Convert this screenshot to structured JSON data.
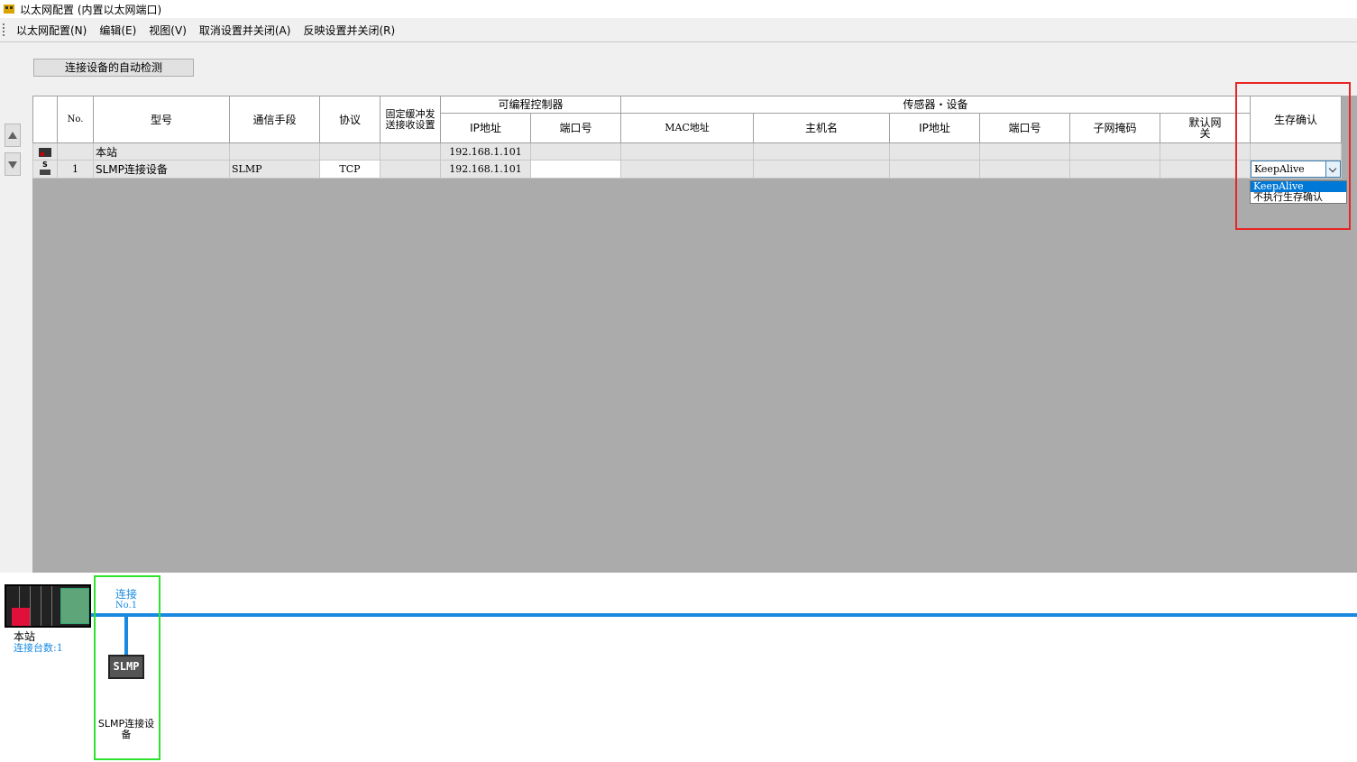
{
  "window": {
    "title": "以太网配置 (内置以太网端口)"
  },
  "menu": [
    {
      "label": "以太网配置(N)"
    },
    {
      "label": "编辑(E)"
    },
    {
      "label": "视图(V)"
    },
    {
      "label": "取消设置并关闭(A)"
    },
    {
      "label": "反映设置并关闭(R)"
    }
  ],
  "toolbar": {
    "auto_detect_label": "连接设备的自动检测"
  },
  "grid": {
    "headers": {
      "no": "No.",
      "model": "型号",
      "comm_means": "通信手段",
      "protocol": "协议",
      "fixed_buffer": "固定缓冲发送接收设置",
      "plc_group": "可编程控制器",
      "plc_ip": "IP地址",
      "plc_port": "端口号",
      "sensor_group": "传感器・设备",
      "mac": "MAC地址",
      "hostname": "主机名",
      "dev_ip": "IP地址",
      "dev_port": "端口号",
      "subnet": "子网掩码",
      "gateway": "默认网关",
      "alive_check": "生存确认"
    },
    "rows": [
      {
        "no": "",
        "model": "本站",
        "comm": "",
        "protocol": "",
        "fixed": "",
        "plc_ip": "192.168.1.101",
        "plc_port": "",
        "alive": ""
      },
      {
        "no": "1",
        "model": "SLMP连接设备",
        "comm": "SLMP",
        "protocol": "TCP",
        "fixed": "",
        "plc_ip": "192.168.1.101",
        "plc_port": "",
        "alive": "KeepAlive"
      }
    ]
  },
  "alive_dropdown": {
    "selected": "KeepAlive",
    "options": [
      "KeepAlive",
      "不执行生存确认"
    ]
  },
  "diagram": {
    "station_label": "本站",
    "count_label": "连接台数:1",
    "connection_label": "连接",
    "connection_no": "No.1",
    "device_icon_text": "SLMP",
    "device_label": "SLMP连接设备"
  },
  "colors": {
    "bus": "#1a8ae0",
    "highlight_red": "#e82424",
    "highlight_green": "#2ee22e",
    "selected": "#0078d7"
  }
}
